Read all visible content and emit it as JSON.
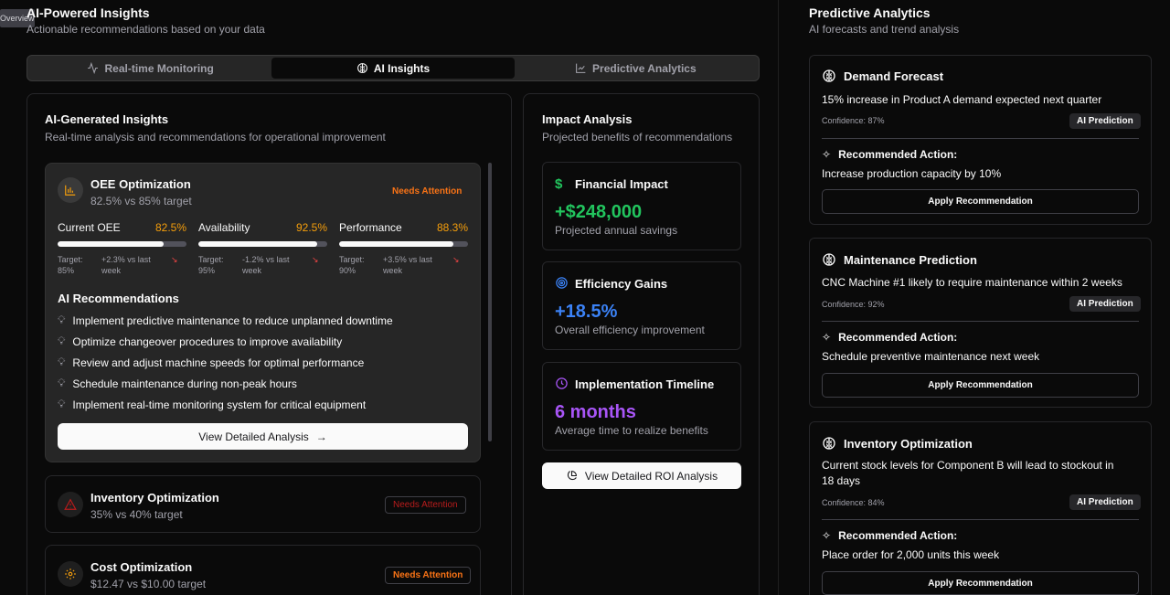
{
  "overview_tab": "Overview",
  "left_header": {
    "title": "AI-Powered Insights",
    "subtitle": "Actionable recommendations based on your data"
  },
  "tabs": [
    {
      "label": "Real-time Monitoring",
      "icon": "activity-icon",
      "active": false
    },
    {
      "label": "AI Insights",
      "icon": "brain-icon",
      "active": true
    },
    {
      "label": "Predictive Analytics",
      "icon": "line-chart-icon",
      "active": false
    }
  ],
  "insights": {
    "title": "AI-Generated Insights",
    "subtitle": "Real-time analysis and recommendations for operational improvement",
    "oee": {
      "title": "OEE Optimization",
      "subtitle": "82.5% vs 85% target",
      "badge": "Needs Attention",
      "metrics": [
        {
          "label": "Current OEE",
          "value": "82.5%",
          "progress": 0.825,
          "target": "Target: 85%",
          "trend": "+2.3% vs last week"
        },
        {
          "label": "Availability",
          "value": "92.5%",
          "progress": 0.925,
          "target": "Target: 95%",
          "trend": "-1.2% vs last week"
        },
        {
          "label": "Performance",
          "value": "88.3%",
          "progress": 0.883,
          "target": "Target: 90%",
          "trend": "+3.5% vs last week"
        }
      ],
      "rec_title": "AI Recommendations",
      "recommendations": [
        "Implement predictive maintenance to reduce unplanned downtime",
        "Optimize changeover procedures to improve availability",
        "Review and adjust machine speeds for optimal performance",
        "Schedule maintenance during non-peak hours",
        "Implement real-time monitoring system for critical equipment"
      ],
      "button": "View Detailed Analysis"
    },
    "inventory": {
      "title": "Inventory Optimization",
      "subtitle": "35% vs 40% target",
      "badge": "Needs Attention"
    },
    "cost": {
      "title": "Cost Optimization",
      "subtitle": "$12.47 vs $10.00 target",
      "badge": "Needs Attention"
    }
  },
  "impact": {
    "title": "Impact Analysis",
    "subtitle": "Projected benefits of recommendations",
    "financial": {
      "title": "Financial Impact",
      "value": "+$248,000",
      "note": "Projected annual savings",
      "color": "#22c55e"
    },
    "efficiency": {
      "title": "Efficiency Gains",
      "value": "+18.5%",
      "note": "Overall efficiency improvement",
      "color": "#3b82f6"
    },
    "timeline": {
      "title": "Implementation Timeline",
      "value": "6 months",
      "note": "Average time to realize benefits",
      "color": "#a855f7"
    },
    "button": "View Detailed ROI Analysis"
  },
  "predictive": {
    "title": "Predictive Analytics",
    "subtitle": "AI forecasts and trend analysis",
    "badge": "AI Prediction",
    "action_label": "Recommended Action:",
    "apply": "Apply Recommendation",
    "cards": [
      {
        "title": "Demand Forecast",
        "desc": "15% increase in Product A demand expected next quarter",
        "confidence": "Confidence: 87%",
        "action": "Increase production capacity by 10%"
      },
      {
        "title": "Maintenance Prediction",
        "desc": "CNC Machine #1 likely to require maintenance within 2 weeks",
        "confidence": "Confidence: 92%",
        "action": "Schedule preventive maintenance next week"
      },
      {
        "title": "Inventory Optimization",
        "desc": "Current stock levels for Component B will lead to stockout in 18 days",
        "confidence": "Confidence: 84%",
        "action": "Place order for 2,000 units this week"
      }
    ]
  }
}
